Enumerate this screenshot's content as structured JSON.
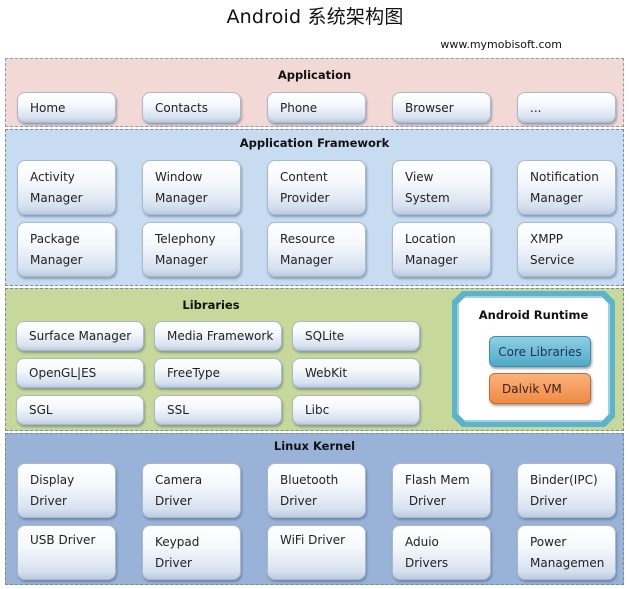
{
  "title": "Android  系统架构图",
  "url": "www.mymobisoft.com",
  "layers": {
    "application": {
      "title": "Application",
      "color": "#f2d9d6",
      "items": [
        "Home",
        "Contacts",
        "Phone",
        "Browser",
        "..."
      ]
    },
    "framework": {
      "title": "Application Framework",
      "color": "#c7dbf1",
      "items": [
        [
          "Activity",
          "Manager"
        ],
        [
          "Window",
          "Manager"
        ],
        [
          "Content",
          "Provider"
        ],
        [
          "View",
          "System"
        ],
        [
          "Notification",
          "Manager"
        ],
        [
          "Package",
          "Manager"
        ],
        [
          "Telephony",
          "Manager"
        ],
        [
          "Resource",
          "Manager"
        ],
        [
          "Location",
          "Manager"
        ],
        [
          "XMPP",
          "Service"
        ]
      ]
    },
    "libraries": {
      "title": "Libraries",
      "color": "#c7d89b",
      "items": [
        "Surface Manager",
        "Media Framework",
        "SQLite",
        "OpenGL|ES",
        "FreeType",
        "WebKit",
        "SGL",
        "SSL",
        "Libc"
      ]
    },
    "runtime": {
      "title": "Android Runtime",
      "items": [
        {
          "label": "Core Libraries",
          "color": "#5fb6d4"
        },
        {
          "label": "Dalvik VM",
          "color": "#f49a58"
        }
      ]
    },
    "kernel": {
      "title": "Linux Kernel",
      "color": "#99b3d8",
      "items": [
        [
          "Display",
          "Driver"
        ],
        [
          "Camera",
          "Driver"
        ],
        [
          "Bluetooth",
          "Driver"
        ],
        [
          "Flash Mem",
          " Driver"
        ],
        [
          "Binder(IPC)",
          "Driver"
        ],
        [
          "USB Driver",
          ""
        ],
        [
          "Keypad",
          "Driver"
        ],
        [
          "WiFi Driver",
          ""
        ],
        [
          "Aduio",
          "Drivers"
        ],
        [
          "Power",
          "Managemen"
        ]
      ]
    }
  }
}
